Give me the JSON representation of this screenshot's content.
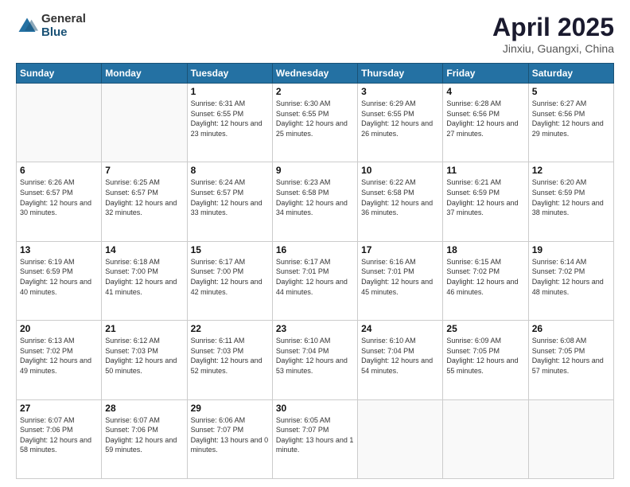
{
  "logo": {
    "general": "General",
    "blue": "Blue"
  },
  "title": {
    "month_year": "April 2025",
    "location": "Jinxiu, Guangxi, China"
  },
  "weekdays": [
    "Sunday",
    "Monday",
    "Tuesday",
    "Wednesday",
    "Thursday",
    "Friday",
    "Saturday"
  ],
  "weeks": [
    [
      {
        "day": "",
        "sunrise": "",
        "sunset": "",
        "daylight": ""
      },
      {
        "day": "",
        "sunrise": "",
        "sunset": "",
        "daylight": ""
      },
      {
        "day": "1",
        "sunrise": "Sunrise: 6:31 AM",
        "sunset": "Sunset: 6:55 PM",
        "daylight": "Daylight: 12 hours and 23 minutes."
      },
      {
        "day": "2",
        "sunrise": "Sunrise: 6:30 AM",
        "sunset": "Sunset: 6:55 PM",
        "daylight": "Daylight: 12 hours and 25 minutes."
      },
      {
        "day": "3",
        "sunrise": "Sunrise: 6:29 AM",
        "sunset": "Sunset: 6:55 PM",
        "daylight": "Daylight: 12 hours and 26 minutes."
      },
      {
        "day": "4",
        "sunrise": "Sunrise: 6:28 AM",
        "sunset": "Sunset: 6:56 PM",
        "daylight": "Daylight: 12 hours and 27 minutes."
      },
      {
        "day": "5",
        "sunrise": "Sunrise: 6:27 AM",
        "sunset": "Sunset: 6:56 PM",
        "daylight": "Daylight: 12 hours and 29 minutes."
      }
    ],
    [
      {
        "day": "6",
        "sunrise": "Sunrise: 6:26 AM",
        "sunset": "Sunset: 6:57 PM",
        "daylight": "Daylight: 12 hours and 30 minutes."
      },
      {
        "day": "7",
        "sunrise": "Sunrise: 6:25 AM",
        "sunset": "Sunset: 6:57 PM",
        "daylight": "Daylight: 12 hours and 32 minutes."
      },
      {
        "day": "8",
        "sunrise": "Sunrise: 6:24 AM",
        "sunset": "Sunset: 6:57 PM",
        "daylight": "Daylight: 12 hours and 33 minutes."
      },
      {
        "day": "9",
        "sunrise": "Sunrise: 6:23 AM",
        "sunset": "Sunset: 6:58 PM",
        "daylight": "Daylight: 12 hours and 34 minutes."
      },
      {
        "day": "10",
        "sunrise": "Sunrise: 6:22 AM",
        "sunset": "Sunset: 6:58 PM",
        "daylight": "Daylight: 12 hours and 36 minutes."
      },
      {
        "day": "11",
        "sunrise": "Sunrise: 6:21 AM",
        "sunset": "Sunset: 6:59 PM",
        "daylight": "Daylight: 12 hours and 37 minutes."
      },
      {
        "day": "12",
        "sunrise": "Sunrise: 6:20 AM",
        "sunset": "Sunset: 6:59 PM",
        "daylight": "Daylight: 12 hours and 38 minutes."
      }
    ],
    [
      {
        "day": "13",
        "sunrise": "Sunrise: 6:19 AM",
        "sunset": "Sunset: 6:59 PM",
        "daylight": "Daylight: 12 hours and 40 minutes."
      },
      {
        "day": "14",
        "sunrise": "Sunrise: 6:18 AM",
        "sunset": "Sunset: 7:00 PM",
        "daylight": "Daylight: 12 hours and 41 minutes."
      },
      {
        "day": "15",
        "sunrise": "Sunrise: 6:17 AM",
        "sunset": "Sunset: 7:00 PM",
        "daylight": "Daylight: 12 hours and 42 minutes."
      },
      {
        "day": "16",
        "sunrise": "Sunrise: 6:17 AM",
        "sunset": "Sunset: 7:01 PM",
        "daylight": "Daylight: 12 hours and 44 minutes."
      },
      {
        "day": "17",
        "sunrise": "Sunrise: 6:16 AM",
        "sunset": "Sunset: 7:01 PM",
        "daylight": "Daylight: 12 hours and 45 minutes."
      },
      {
        "day": "18",
        "sunrise": "Sunrise: 6:15 AM",
        "sunset": "Sunset: 7:02 PM",
        "daylight": "Daylight: 12 hours and 46 minutes."
      },
      {
        "day": "19",
        "sunrise": "Sunrise: 6:14 AM",
        "sunset": "Sunset: 7:02 PM",
        "daylight": "Daylight: 12 hours and 48 minutes."
      }
    ],
    [
      {
        "day": "20",
        "sunrise": "Sunrise: 6:13 AM",
        "sunset": "Sunset: 7:02 PM",
        "daylight": "Daylight: 12 hours and 49 minutes."
      },
      {
        "day": "21",
        "sunrise": "Sunrise: 6:12 AM",
        "sunset": "Sunset: 7:03 PM",
        "daylight": "Daylight: 12 hours and 50 minutes."
      },
      {
        "day": "22",
        "sunrise": "Sunrise: 6:11 AM",
        "sunset": "Sunset: 7:03 PM",
        "daylight": "Daylight: 12 hours and 52 minutes."
      },
      {
        "day": "23",
        "sunrise": "Sunrise: 6:10 AM",
        "sunset": "Sunset: 7:04 PM",
        "daylight": "Daylight: 12 hours and 53 minutes."
      },
      {
        "day": "24",
        "sunrise": "Sunrise: 6:10 AM",
        "sunset": "Sunset: 7:04 PM",
        "daylight": "Daylight: 12 hours and 54 minutes."
      },
      {
        "day": "25",
        "sunrise": "Sunrise: 6:09 AM",
        "sunset": "Sunset: 7:05 PM",
        "daylight": "Daylight: 12 hours and 55 minutes."
      },
      {
        "day": "26",
        "sunrise": "Sunrise: 6:08 AM",
        "sunset": "Sunset: 7:05 PM",
        "daylight": "Daylight: 12 hours and 57 minutes."
      }
    ],
    [
      {
        "day": "27",
        "sunrise": "Sunrise: 6:07 AM",
        "sunset": "Sunset: 7:06 PM",
        "daylight": "Daylight: 12 hours and 58 minutes."
      },
      {
        "day": "28",
        "sunrise": "Sunrise: 6:07 AM",
        "sunset": "Sunset: 7:06 PM",
        "daylight": "Daylight: 12 hours and 59 minutes."
      },
      {
        "day": "29",
        "sunrise": "Sunrise: 6:06 AM",
        "sunset": "Sunset: 7:07 PM",
        "daylight": "Daylight: 13 hours and 0 minutes."
      },
      {
        "day": "30",
        "sunrise": "Sunrise: 6:05 AM",
        "sunset": "Sunset: 7:07 PM",
        "daylight": "Daylight: 13 hours and 1 minute."
      },
      {
        "day": "",
        "sunrise": "",
        "sunset": "",
        "daylight": ""
      },
      {
        "day": "",
        "sunrise": "",
        "sunset": "",
        "daylight": ""
      },
      {
        "day": "",
        "sunrise": "",
        "sunset": "",
        "daylight": ""
      }
    ]
  ]
}
